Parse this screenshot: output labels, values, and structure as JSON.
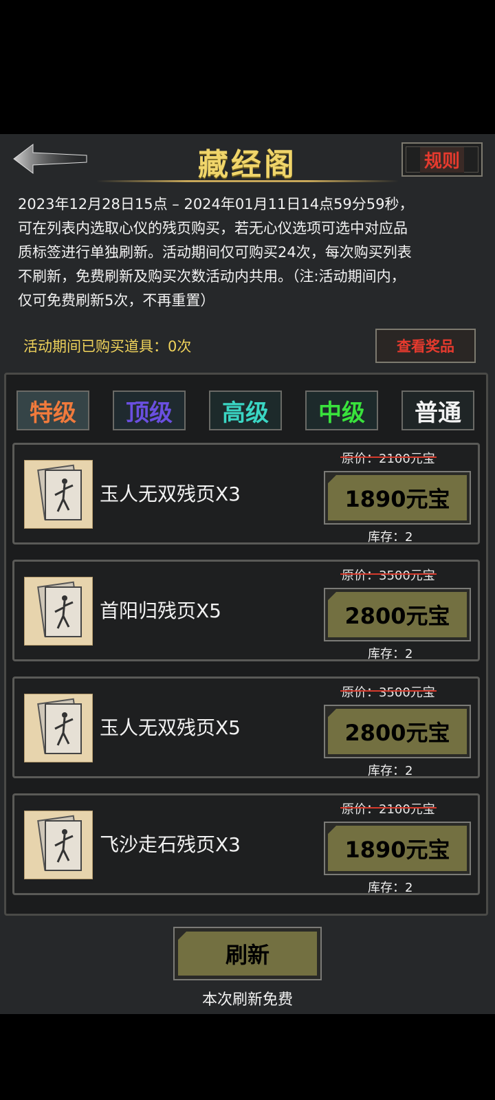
{
  "header": {
    "title": "藏经阁",
    "rules_label": "规则"
  },
  "description": [
    "2023年12月28日15点 – 2024年01月11日14点59分59秒，",
    "可在列表内选取心仪的残页购买，若无心仪选项可选中对应品",
    "质标签进行单独刷新。活动期间仅可购买24次，每次购买列表",
    "不刷新，免费刷新及购买次数活动内共用。（注:活动期间内，",
    "仅可免费刷新5次，不再重置）"
  ],
  "bought_text": "活动期间已购买道具：0次",
  "prize_label": "查看奖品",
  "tabs": [
    {
      "label": "特级",
      "color": "#f07a3c",
      "bg": "#354447"
    },
    {
      "label": "顶级",
      "color": "#6a4fe0",
      "bg": "#1f2a2f"
    },
    {
      "label": "高级",
      "color": "#3ad6c4",
      "bg": "#1d2a2b"
    },
    {
      "label": "中级",
      "color": "#39e23c",
      "bg": "#1d2a2b"
    },
    {
      "label": "普通",
      "color": "#f2f2f2",
      "bg": "#1f2526"
    }
  ],
  "items": [
    {
      "name": "玉人无双残页X3",
      "original_price": "原价：2100元宝",
      "price": "1890元宝",
      "stock": "库存：2"
    },
    {
      "name": "首阳归残页X5",
      "original_price": "原价：3500元宝",
      "price": "2800元宝",
      "stock": "库存：2"
    },
    {
      "name": "玉人无双残页X5",
      "original_price": "原价：3500元宝",
      "price": "2800元宝",
      "stock": "库存：2"
    },
    {
      "name": "飞沙走石残页X3",
      "original_price": "原价：2100元宝",
      "price": "1890元宝",
      "stock": "库存：2"
    }
  ],
  "refresh": {
    "label": "刷新",
    "note": "本次刷新免费"
  }
}
